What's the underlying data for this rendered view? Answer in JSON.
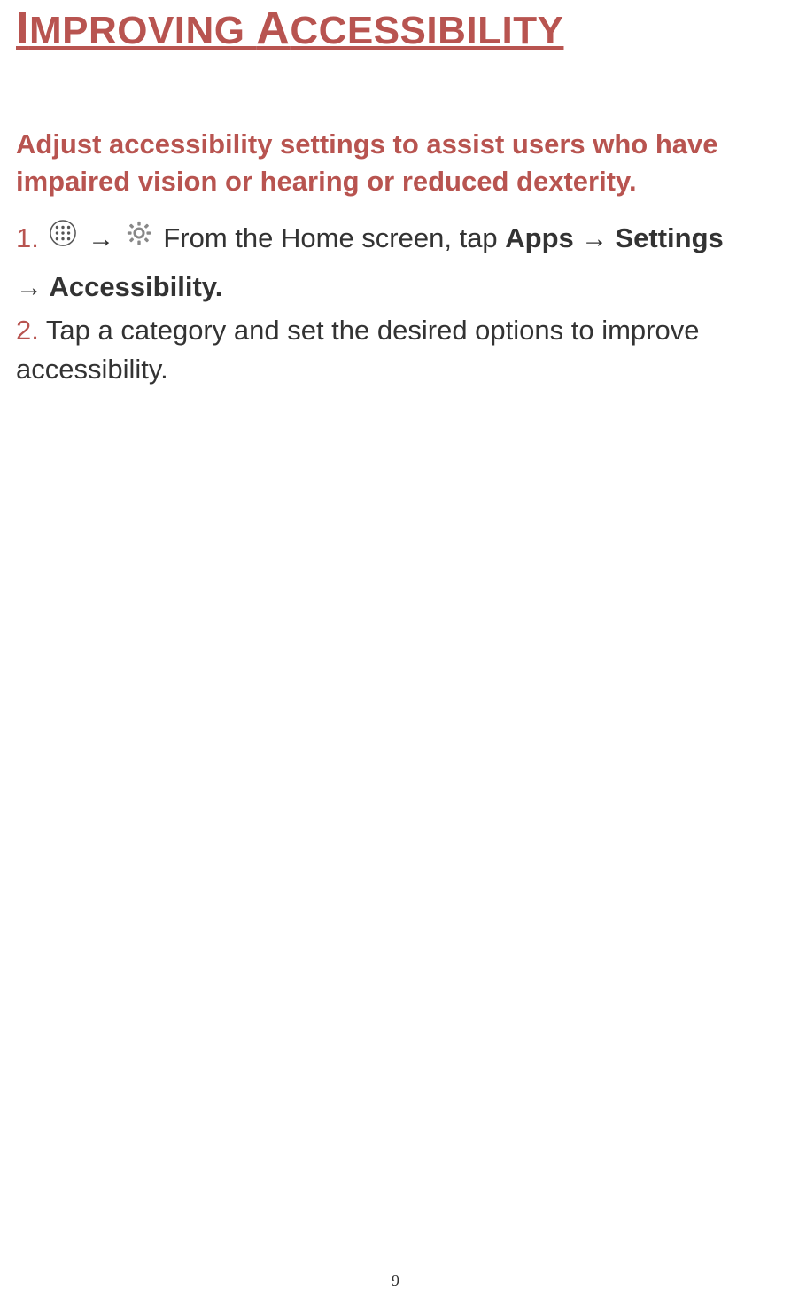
{
  "heading": {
    "part1_cap": "I",
    "part1_rest": "MPROVING ",
    "part2_cap": "A",
    "part2_rest": "CCESSIBILITY"
  },
  "intro": "Adjust accessibility settings to assist users who have impaired vision or hearing or reduced dexterity.",
  "step1": {
    "num": "1.",
    "arrow1": "→",
    "text_mid": " From the Home screen, tap ",
    "apps": "Apps",
    "arrow2": " → ",
    "settings": "Settings"
  },
  "step1_cont": {
    "arrow": "→",
    "accessibility": " Accessibility."
  },
  "step2": {
    "num": "2.",
    "text": " Tap a category and set the desired options to improve accessibility."
  },
  "page_number": "9"
}
